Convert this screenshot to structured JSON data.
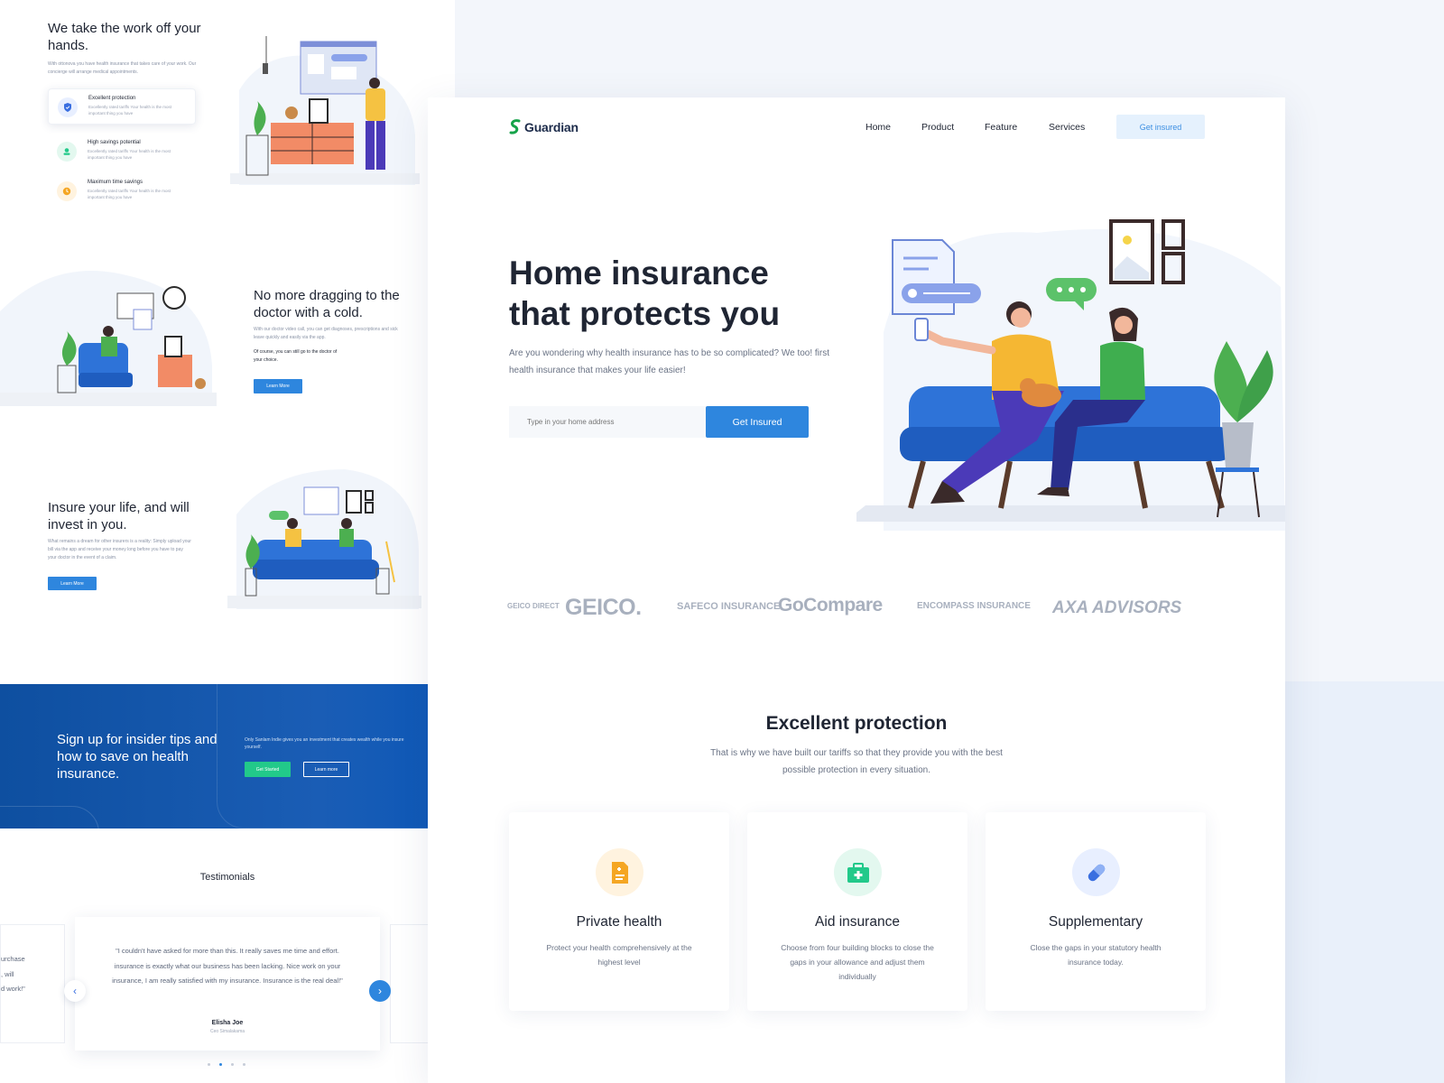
{
  "left": {
    "section1": {
      "title": "We take the work off your hands.",
      "desc": "With ottonova you have health insurance that takes care of your work. Our concierge will arrange medical appointments.",
      "features": [
        {
          "title": "Excellent protection",
          "desc": "Excellently rated tariffs Your health is the most important thing you have",
          "icon": "shield-icon"
        },
        {
          "title": "High savings potential",
          "desc": "Excellently rated tariffs Your health is the most important thing you have",
          "icon": "savings-icon"
        },
        {
          "title": "Maximum time savings",
          "desc": "Excellently rated tariffs Your health is the most important thing you have",
          "icon": "clock-icon"
        }
      ]
    },
    "section2": {
      "title": "No more dragging to the doctor with a cold.",
      "desc": "With our doctor video call, you can get diagnoses, prescriptions and sick leave quickly and easily via the app.",
      "note": "Of course, you can still go to the doctor of your choice.",
      "button": "Learn More"
    },
    "section3": {
      "title": "Insure your life, and will invest in you.",
      "desc": "What remains a dream for other insurers is a reality: Simply upload your bill via the app and receive your money long before you have to pay your doctor in the event of a claim.",
      "button": "Learn More"
    },
    "cta": {
      "title": "Sign up for insider tips and how to save on health insurance.",
      "desc": "Only Sanlam Indie gives you an investment that creates wealth while you insure yourself.",
      "primary": "Get Started",
      "secondary": "Learn more"
    },
    "testimonials": {
      "title": "Testimonials",
      "quote": "\"I couldn't have asked for more than this. It really saves me time and effort. insurance is exactly what our business has been lacking. Nice work on your insurance, I am really satisfied with my insurance. Insurance is the real deal!\"",
      "name": "Elisha Joe",
      "role": "Ceo Simalakama",
      "side_text": "urchase\n, will\nd work!\"",
      "prev": "‹",
      "next": "›"
    }
  },
  "right": {
    "logo": "Guardian",
    "nav": [
      "Home",
      "Product",
      "Feature",
      "Services"
    ],
    "nav_cta": "Get insured",
    "hero": {
      "title": "Home insurance that protects you",
      "subtitle": "Are you wondering why health insurance has to be so complicated? We too! first health insurance that makes your life easier!",
      "input_placeholder": "Type in your home address",
      "button": "Get Insured"
    },
    "brands": [
      "GEICO DIRECT",
      "GEICO.",
      "SAFECO INSURANCE",
      "GoCompare",
      "ENCOMPASS INSURANCE",
      "AXA ADVISORS"
    ],
    "section": {
      "title": "Excellent protection",
      "subtitle": "That is why we have built our tariffs so that they provide you with the best possible protection in every situation."
    },
    "cards": [
      {
        "title": "Private health",
        "desc": "Protect your health comprehensively at the highest level",
        "icon": "document-icon",
        "color": "#f5a623"
      },
      {
        "title": "Aid insurance",
        "desc": "Choose from four building blocks to close the gaps in your allowance and adjust them individually",
        "icon": "medkit-icon",
        "color": "#22c98a"
      },
      {
        "title": "Supplementary",
        "desc": "Close the gaps in your statutory health insurance today.",
        "icon": "pill-icon",
        "color": "#3a6fe0"
      }
    ]
  },
  "colors": {
    "primary": "#2e86de",
    "dark_text": "#1f2533",
    "cta_band": "#0e4fa0",
    "green": "#22c98a"
  }
}
